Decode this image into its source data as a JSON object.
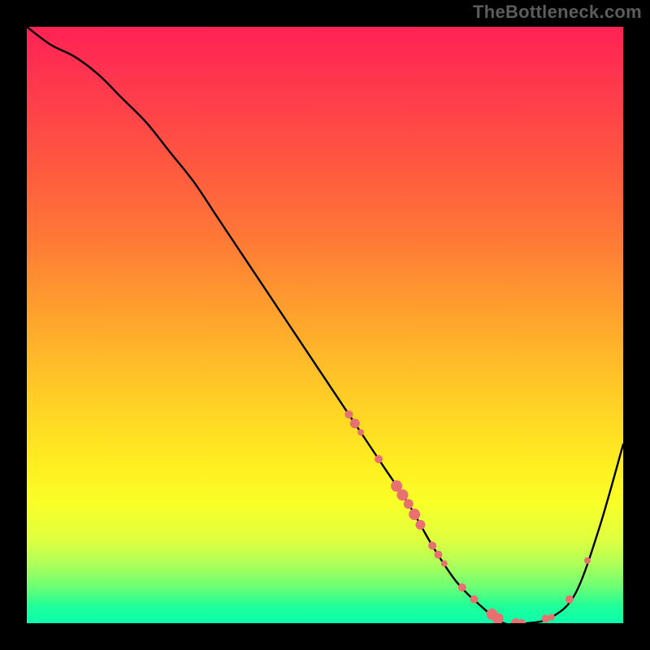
{
  "watermark": "TheBottleneck.com",
  "chart_data": {
    "type": "line",
    "title": "",
    "xlabel": "",
    "ylabel": "",
    "xlim": [
      0,
      100
    ],
    "ylim": [
      0,
      100
    ],
    "grid": false,
    "series": [
      {
        "name": "curve",
        "x": [
          0,
          4,
          8,
          12,
          16,
          20,
          24,
          28,
          32,
          36,
          40,
          44,
          48,
          52,
          56,
          60,
          64,
          68,
          72,
          76,
          80,
          84,
          88,
          92,
          96,
          100
        ],
        "y": [
          100,
          97,
          95,
          92,
          88,
          84,
          79,
          74,
          68,
          62,
          56,
          50,
          44,
          38,
          32,
          26,
          20,
          13,
          7,
          3,
          0,
          0,
          1,
          5,
          16,
          30
        ]
      }
    ],
    "markers": {
      "name": "highlight-points",
      "color": "#e87070",
      "points": [
        {
          "x": 54,
          "r": 5
        },
        {
          "x": 55,
          "r": 6
        },
        {
          "x": 56,
          "r": 4
        },
        {
          "x": 59,
          "r": 5
        },
        {
          "x": 62,
          "r": 7
        },
        {
          "x": 63,
          "r": 7
        },
        {
          "x": 64,
          "r": 6
        },
        {
          "x": 65,
          "r": 7
        },
        {
          "x": 66,
          "r": 6
        },
        {
          "x": 68,
          "r": 5
        },
        {
          "x": 69,
          "r": 5
        },
        {
          "x": 70,
          "r": 4
        },
        {
          "x": 73,
          "r": 5
        },
        {
          "x": 75,
          "r": 5
        },
        {
          "x": 78,
          "r": 7
        },
        {
          "x": 79,
          "r": 7
        },
        {
          "x": 82,
          "r": 6
        },
        {
          "x": 83,
          "r": 5
        },
        {
          "x": 87,
          "r": 5
        },
        {
          "x": 88,
          "r": 4
        },
        {
          "x": 91,
          "r": 5
        },
        {
          "x": 94,
          "r": 4
        }
      ]
    }
  }
}
